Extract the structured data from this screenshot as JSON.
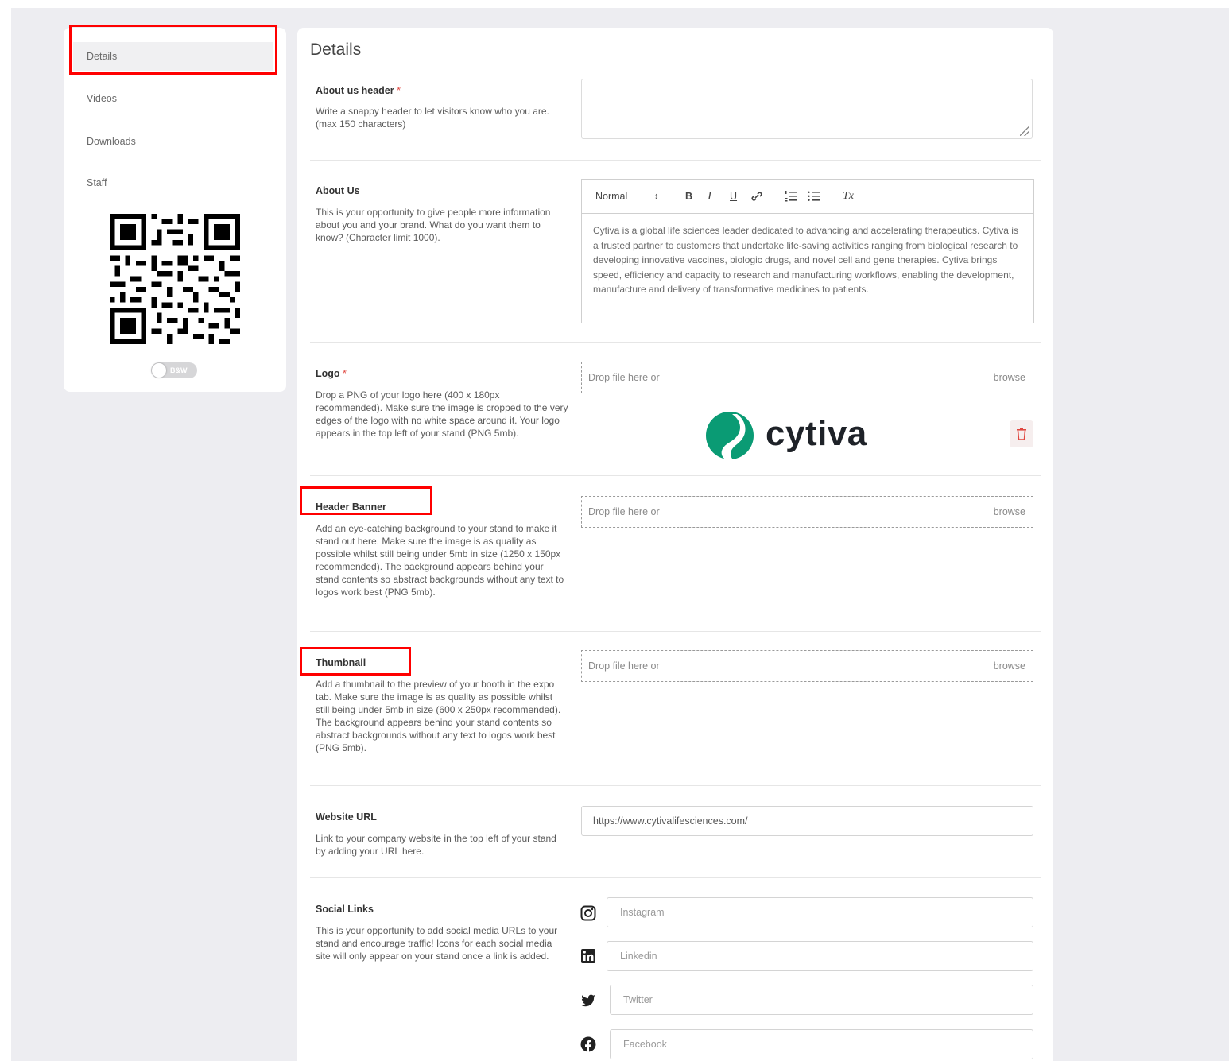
{
  "sidebar": {
    "items": [
      {
        "label": "Details"
      },
      {
        "label": "Videos"
      },
      {
        "label": "Downloads"
      },
      {
        "label": "Staff"
      }
    ],
    "toggle_label": "B&W"
  },
  "main": {
    "title": "Details",
    "about_header": {
      "label": "About us header",
      "required_mark": "*",
      "description": "Write a snappy header to let visitors know who you are. (max 150 characters)",
      "value": ""
    },
    "about_us": {
      "label": "About Us",
      "description": "This is your opportunity to give people more information about you and your brand. What do you want them to know? (Character limit 1000).",
      "toolbar": {
        "format": "Normal",
        "arrows": "↕",
        "bold": "B",
        "italic": "I",
        "underline": "U",
        "clear": "Tx"
      },
      "body": "Cytiva is a global life sciences leader dedicated to advancing and accelerating therapeutics. Cytiva is a trusted partner to customers that undertake life-saving activities ranging from biological research to developing innovative vaccines, biologic drugs, and novel cell and gene therapies. Cytiva brings speed, efficiency and capacity to research and manufacturing workflows, enabling the development, manufacture and delivery of transformative medicines to patients."
    },
    "logo": {
      "label": "Logo",
      "required_mark": "*",
      "description": "Drop a PNG of your logo here (400 x 180px recommended). Make sure the image is cropped to the very edges of the logo with no white space around it. Your logo appears in the top left of your stand (PNG 5mb).",
      "drop_text": "Drop file here or",
      "browse": "browse",
      "logo_text": "cytiva",
      "brand_color": "#0a9b74"
    },
    "header_banner": {
      "label": "Header Banner",
      "description": "Add an eye-catching background to your stand to make it stand out here. Make sure the image is as quality as possible whilst still being under 5mb in size (1250 x 150px recommended). The background appears behind your stand contents so abstract backgrounds without any text to logos work best (PNG 5mb).",
      "drop_text": "Drop file here or",
      "browse": "browse"
    },
    "thumbnail": {
      "label": "Thumbnail",
      "description": "Add a thumbnail to the preview of your booth in the expo tab. Make sure the image is as quality as possible whilst still being under 5mb in size (600 x 250px recommended). The background appears behind your stand contents so abstract backgrounds without any text to logos work best (PNG 5mb).",
      "drop_text": "Drop file here or",
      "browse": "browse"
    },
    "website": {
      "label": "Website URL",
      "description": "Link to your company website in the top left of your stand by adding your URL here.",
      "value": "https://www.cytivalifesciences.com/"
    },
    "social": {
      "label": "Social Links",
      "description": "This is your opportunity to add social media URLs to your stand and encourage traffic! Icons for each social media site will only appear on your stand once a link is added.",
      "instagram_placeholder": "Instagram",
      "linkedin_placeholder": "Linkedin",
      "twitter_placeholder": "Twitter",
      "facebook_placeholder": "Facebook"
    }
  },
  "colors": {
    "annotation": "#ff0000",
    "required": "#e0463f",
    "delete": "#e0463f"
  }
}
